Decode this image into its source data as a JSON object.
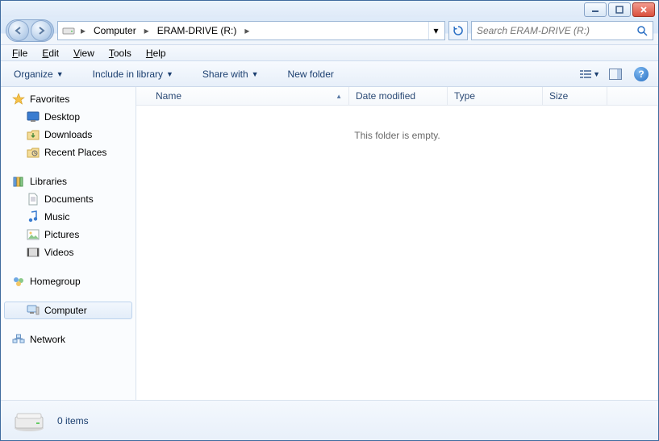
{
  "titlebar": {},
  "nav": {
    "breadcrumb": [
      {
        "label": "Computer"
      },
      {
        "label": "ERAM-DRIVE (R:)"
      }
    ]
  },
  "search": {
    "placeholder": "Search ERAM-DRIVE (R:)"
  },
  "menubar": {
    "file": "File",
    "edit": "Edit",
    "view": "View",
    "tools": "Tools",
    "help": "Help"
  },
  "toolbar": {
    "organize": "Organize",
    "include": "Include in library",
    "share": "Share with",
    "newfolder": "New folder"
  },
  "navpane": {
    "favorites": {
      "label": "Favorites",
      "items": [
        "Desktop",
        "Downloads",
        "Recent Places"
      ]
    },
    "libraries": {
      "label": "Libraries",
      "items": [
        "Documents",
        "Music",
        "Pictures",
        "Videos"
      ]
    },
    "homegroup": {
      "label": "Homegroup"
    },
    "computer": {
      "label": "Computer"
    },
    "network": {
      "label": "Network"
    }
  },
  "columns": {
    "name": "Name",
    "date": "Date modified",
    "type": "Type",
    "size": "Size"
  },
  "content": {
    "empty": "This folder is empty."
  },
  "details": {
    "count": "0 items"
  }
}
